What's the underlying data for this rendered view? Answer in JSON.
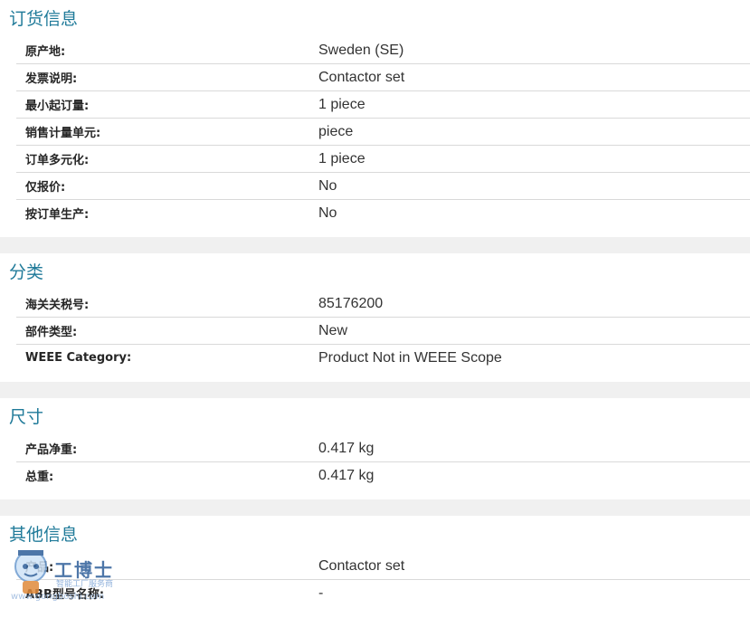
{
  "sections": [
    {
      "title": "订货信息",
      "rows": [
        {
          "label": "原产地:",
          "value": "Sweden (SE)"
        },
        {
          "label": "发票说明:",
          "value": "Contactor set"
        },
        {
          "label": "最小起订量:",
          "value": "1 piece"
        },
        {
          "label": "销售计量单元:",
          "value": "piece"
        },
        {
          "label": "订单多元化:",
          "value": "1 piece"
        },
        {
          "label": "仅报价:",
          "value": "No"
        },
        {
          "label": "按订单生产:",
          "value": "No"
        }
      ]
    },
    {
      "title": "分类",
      "rows": [
        {
          "label": "海关关税号:",
          "value": "85176200"
        },
        {
          "label": "部件类型:",
          "value": "New"
        },
        {
          "label": "WEEE Category:",
          "value": "Product Not in WEEE Scope"
        }
      ]
    },
    {
      "title": "尺寸",
      "rows": [
        {
          "label": "产品净重:",
          "value": "0.417 kg"
        },
        {
          "label": "总重:",
          "value": "0.417 kg"
        }
      ]
    },
    {
      "title": "其他信息",
      "rows": [
        {
          "label": "产品:",
          "value": "Contactor set"
        },
        {
          "label": "ABB型号名称:",
          "value": "-"
        }
      ]
    }
  ],
  "watermark": {
    "brand": "工博士",
    "tagline": "智能工厂服务商",
    "url": "www.gongboshi.com"
  }
}
